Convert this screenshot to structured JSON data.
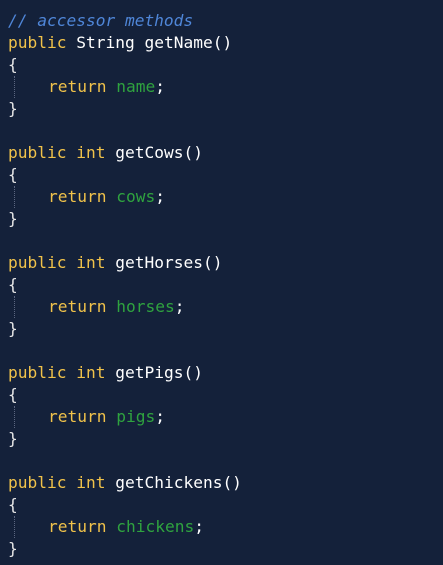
{
  "comment": "// accessor methods",
  "keywords": {
    "public": "public",
    "return": "return"
  },
  "punct": {
    "open_brace": "{",
    "close_brace": "}",
    "parens": "()",
    "semicolon": ";"
  },
  "methods": [
    {
      "return_type": "String",
      "name": "getName",
      "field": "name"
    },
    {
      "return_type": "int",
      "name": "getCows",
      "field": "cows"
    },
    {
      "return_type": "int",
      "name": "getHorses",
      "field": "horses"
    },
    {
      "return_type": "int",
      "name": "getPigs",
      "field": "pigs"
    },
    {
      "return_type": "int",
      "name": "getChickens",
      "field": "chickens"
    }
  ],
  "colors": {
    "background": "#14213a",
    "comment": "#4f86d8",
    "keyword": "#f0c24a",
    "field": "#2fa33f",
    "text": "#ffffff"
  }
}
